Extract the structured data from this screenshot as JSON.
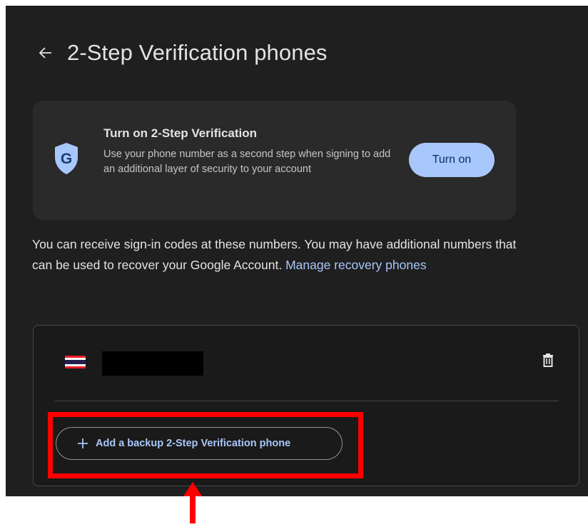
{
  "header": {
    "back_icon": "arrow-back-icon",
    "title": "2-Step Verification phones"
  },
  "promo": {
    "icon": "google-shield-icon",
    "title": "Turn on 2-Step Verification",
    "body": "Use your phone number as a second step when signing to add an additional layer of security to your account",
    "button_label": "Turn on"
  },
  "info": {
    "text": "You can receive sign-in codes at these numbers. You may have additional numbers that can be used to recover your Google Account.",
    "link_text": "Manage recovery phones"
  },
  "phones": {
    "items": [
      {
        "flag": "thailand-flag-icon",
        "number_redacted": true
      }
    ],
    "delete_icon": "trash-icon",
    "add_button_label": "Add a backup 2-Step Verification phone",
    "add_icon": "plus-icon"
  },
  "annotation": {
    "highlight_color": "#ff0000",
    "arrow_icon": "red-up-arrow"
  },
  "colors": {
    "background": "#1f1f1f",
    "accent": "#a8c7fa",
    "text": "#e3e3e3"
  }
}
